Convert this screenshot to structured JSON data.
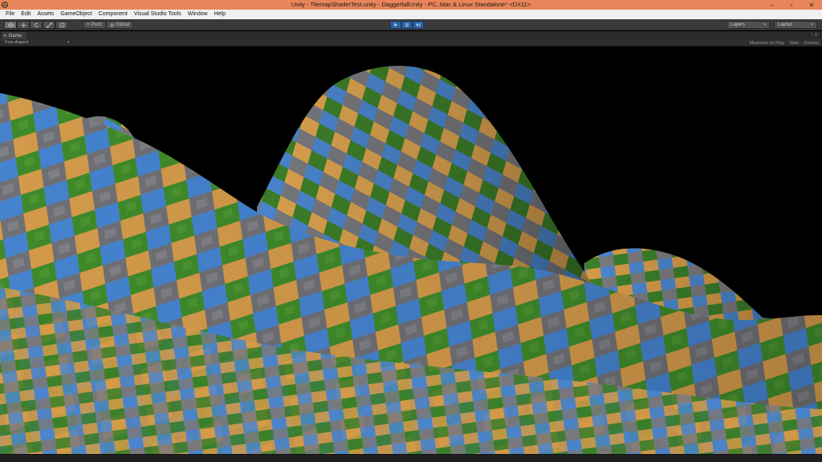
{
  "window": {
    "title": "Unity - TilemapShaderTest.unity - DaggerfallUnity - PC, Mac & Linux Standalone* <DX11>",
    "minimize_glyph": "–",
    "maximize_glyph": "▫",
    "close_glyph": "✕"
  },
  "menu": {
    "items": [
      "File",
      "Edit",
      "Assets",
      "GameObject",
      "Component",
      "Visual Studio Tools",
      "Window",
      "Help"
    ]
  },
  "toolbar": {
    "transform_tools": [
      "hand-icon",
      "move-icon",
      "rotate-icon",
      "scale-icon",
      "rect-icon"
    ],
    "pivot_label": "Pivot",
    "global_label": "Global",
    "play_controls": [
      "play-icon",
      "pause-icon",
      "step-icon"
    ],
    "layers_label": "Layers",
    "layout_label": "Layout",
    "accent_color": "#2f5f9e"
  },
  "game_view": {
    "tab_label": "Game",
    "aspect_label": "Free Aspect",
    "maximize_label": "Maximize on Play",
    "stats_label": "Stats",
    "gizmos_label": "Gizmos"
  },
  "terrain_palette": {
    "water": "#3f7fcf",
    "grass": "#3f8a2a",
    "sand": "#d39a4a",
    "rock": "#7c7c80",
    "snow": "#c8c8c8"
  }
}
